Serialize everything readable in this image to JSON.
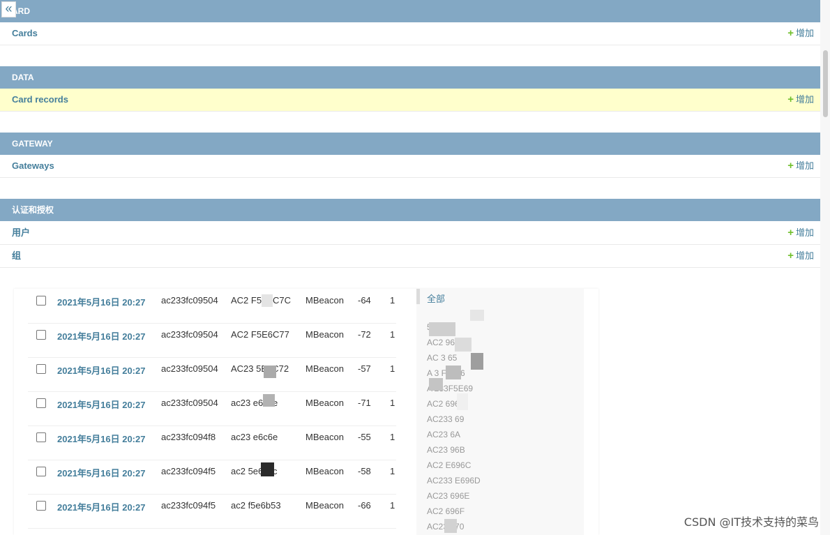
{
  "collapse_icon": "«",
  "modules": [
    {
      "header": "ARD",
      "rows": [
        {
          "name": "Cards",
          "add": "增加",
          "highlight": false
        }
      ]
    },
    {
      "header": "DATA",
      "rows": [
        {
          "name": "Card records",
          "add": "增加",
          "highlight": true
        }
      ]
    },
    {
      "header": "GATEWAY",
      "rows": [
        {
          "name": "Gateways",
          "add": "增加",
          "highlight": false
        }
      ]
    },
    {
      "header": "认证和授权",
      "rows": [
        {
          "name": "用户",
          "add": "增加",
          "highlight": false
        },
        {
          "name": "组",
          "add": "增加",
          "highlight": false
        }
      ]
    }
  ],
  "records": [
    {
      "time": "2021年5月16日 20:27",
      "gateway": "ac233fc09504",
      "mac": "AC2  F5E6C7C",
      "type": "MBeacon",
      "rssi": "-64",
      "cut": "1"
    },
    {
      "time": "2021年5月16日 20:27",
      "gateway": "ac233fc09504",
      "mac": "AC2   F5E6C77",
      "type": "MBeacon",
      "rssi": "-72",
      "cut": "1"
    },
    {
      "time": "2021年5月16日 20:27",
      "gateway": "ac233fc09504",
      "mac": "AC23   5E6C72",
      "type": "MBeacon",
      "rssi": "-57",
      "cut": "1"
    },
    {
      "time": "2021年5月16日 20:27",
      "gateway": "ac233fc09504",
      "mac": "ac23   e6c5e",
      "type": "MBeacon",
      "rssi": "-71",
      "cut": "1"
    },
    {
      "time": "2021年5月16日 20:27",
      "gateway": "ac233fc094f8",
      "mac": "ac23   e6c6e",
      "type": "MBeacon",
      "rssi": "-55",
      "cut": "1"
    },
    {
      "time": "2021年5月16日 20:27",
      "gateway": "ac233fc094f5",
      "mac": "ac2   5e6c5c",
      "type": "MBeacon",
      "rssi": "-58",
      "cut": "1"
    },
    {
      "time": "2021年5月16日 20:27",
      "gateway": "ac233fc094f5",
      "mac": "ac2   f5e6b53",
      "type": "MBeacon",
      "rssi": "-66",
      "cut": "1"
    }
  ],
  "filter": {
    "all": "全部",
    "items": [
      "    5963",
      "AC2    964",
      "AC   3   65",
      "A  3  F6966",
      "A 233F5E69",
      "AC2    6968",
      "AC233    69",
      "AC23   6A",
      "AC23    96B",
      "AC2    E696C",
      "AC233   E696D",
      "AC23    696E",
      "AC2    696F",
      "AC23    970"
    ]
  },
  "watermark": "CSDN @IT技术支持的菜鸟",
  "colors": {
    "header_bg": "#83a8c4",
    "link": "#447e9b",
    "add_plus": "#70bf2b",
    "highlight_row": "#ffffcc"
  }
}
